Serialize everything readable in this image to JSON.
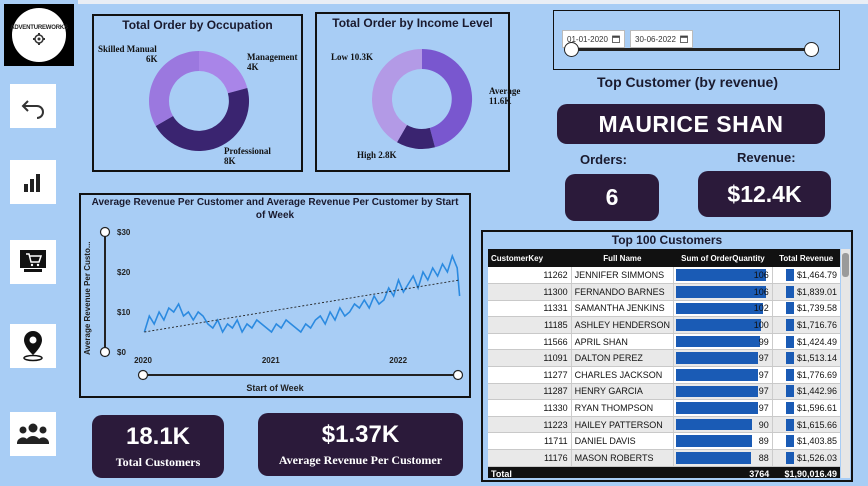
{
  "logo": {
    "text": "ADVENTUREWORKS"
  },
  "nav": [
    {
      "name": "back-icon"
    },
    {
      "name": "bar-chart-icon"
    },
    {
      "name": "shopping-cart-icon"
    },
    {
      "name": "map-pin-icon"
    },
    {
      "name": "people-icon"
    }
  ],
  "occupation": {
    "title": "Total Order by Occupation",
    "skilled_manual": "Skilled Manual",
    "skilled_manual_val": "6K",
    "management": "Management",
    "management_val": "4K",
    "professional": "Professional",
    "professional_val": "8K",
    "colors": [
      "#a985e8",
      "#7a57c9",
      "#3a2470"
    ]
  },
  "income": {
    "title": "Total Order by Income Level",
    "low": "Low 10.3K",
    "average": "Average",
    "average_val": "11.6K",
    "high": "High 2.8K",
    "colors": [
      "#b39ae6",
      "#7957cf",
      "#3a2470"
    ]
  },
  "date_slicer": {
    "start": "01-01-2020",
    "end": "30-06-2022"
  },
  "top_customer": {
    "label": "Top Customer (by revenue)",
    "name": "MAURICE SHAN",
    "orders_label": "Orders:",
    "orders_value": "6",
    "revenue_label": "Revenue:",
    "revenue_value": "$12.4K"
  },
  "line_chart": {
    "title": "Average Revenue Per Customer and Average Revenue Per Customer by Start of Week",
    "ylabel": "Average Revenue Per Custo...",
    "xlabel": "Start of Week",
    "yticks": [
      "$30",
      "$20",
      "$10",
      "$0"
    ],
    "xticks": [
      "2020",
      "2021",
      "2022"
    ]
  },
  "chart_data": {
    "type": "line",
    "title": "Average Revenue Per Customer and Average Revenue Per Customer by Start of Week",
    "xlabel": "Start of Week",
    "ylabel": "Average Revenue Per Custo...",
    "ylim": [
      0,
      30
    ],
    "x_range": [
      "2020-01-01",
      "2022-06-30"
    ],
    "series": [
      {
        "x": [
          "2020-01-05",
          "2020-01-19",
          "2020-02-02",
          "2020-02-16",
          "2020-03-01",
          "2020-03-15",
          "2020-03-29",
          "2020-04-12",
          "2020-04-26",
          "2020-05-10",
          "2020-05-24",
          "2020-06-07",
          "2020-06-21",
          "2020-07-05",
          "2020-07-19",
          "2020-08-02",
          "2020-08-16",
          "2020-08-30",
          "2020-09-13",
          "2020-09-27",
          "2020-10-11",
          "2020-10-25",
          "2020-11-08",
          "2020-11-22",
          "2020-12-06",
          "2020-12-20",
          "2021-01-03",
          "2021-01-17",
          "2021-01-31",
          "2021-02-14",
          "2021-02-28",
          "2021-03-14",
          "2021-03-28",
          "2021-04-11",
          "2021-04-25",
          "2021-05-09",
          "2021-05-23",
          "2021-06-06",
          "2021-06-20",
          "2021-07-04",
          "2021-07-18",
          "2021-08-01",
          "2021-08-15",
          "2021-08-29",
          "2021-09-12",
          "2021-09-26",
          "2021-10-10",
          "2021-10-24",
          "2021-11-07",
          "2021-11-21",
          "2021-12-05",
          "2021-12-19",
          "2022-01-02",
          "2022-01-16",
          "2022-01-30",
          "2022-02-13",
          "2022-02-27",
          "2022-03-13",
          "2022-03-27",
          "2022-04-10",
          "2022-04-24",
          "2022-05-08",
          "2022-05-22",
          "2022-06-05",
          "2022-06-19",
          "2022-06-26"
        ],
        "values": [
          5,
          9,
          7,
          10,
          8,
          11,
          10,
          12,
          9,
          10,
          8,
          10,
          9,
          7,
          6,
          8,
          5,
          7,
          6,
          8,
          5,
          7,
          6,
          8,
          7,
          6,
          5,
          7,
          6,
          8,
          7,
          6,
          5,
          7,
          6,
          8,
          9,
          7,
          10,
          8,
          11,
          9,
          10,
          12,
          11,
          13,
          11,
          14,
          12,
          13,
          16,
          14,
          18,
          15,
          17,
          19,
          16,
          20,
          18,
          21,
          19,
          22,
          20,
          24,
          21,
          14
        ]
      },
      {
        "x": [
          "2020-01-05",
          "2022-06-26"
        ],
        "values": [
          5,
          18
        ]
      }
    ]
  },
  "kpis": {
    "total_customers_value": "18.1K",
    "total_customers_label": "Total Customers",
    "avg_rev_value": "$1.37K",
    "avg_rev_label": "Average Revenue Per Customer"
  },
  "table": {
    "title": "Top 100 Customers",
    "headers": [
      "CustomerKey",
      "Full Name",
      "Sum of OrderQuantity",
      "Total Revenue"
    ],
    "qty_max": 106,
    "rows": [
      {
        "key": "11262",
        "name": "JENNIFER SIMMONS",
        "qty": "106",
        "qty_n": 106,
        "rev": "$1,464.79"
      },
      {
        "key": "11300",
        "name": "FERNANDO BARNES",
        "qty": "106",
        "qty_n": 106,
        "rev": "$1,839.01"
      },
      {
        "key": "11331",
        "name": "SAMANTHA JENKINS",
        "qty": "102",
        "qty_n": 102,
        "rev": "$1,739.58"
      },
      {
        "key": "11185",
        "name": "ASHLEY HENDERSON",
        "qty": "100",
        "qty_n": 100,
        "rev": "$1,716.76"
      },
      {
        "key": "11566",
        "name": "APRIL SHAN",
        "qty": "99",
        "qty_n": 99,
        "rev": "$1,424.49"
      },
      {
        "key": "11091",
        "name": "DALTON PEREZ",
        "qty": "97",
        "qty_n": 97,
        "rev": "$1,513.14"
      },
      {
        "key": "11277",
        "name": "CHARLES JACKSON",
        "qty": "97",
        "qty_n": 97,
        "rev": "$1,776.69"
      },
      {
        "key": "11287",
        "name": "HENRY GARCIA",
        "qty": "97",
        "qty_n": 97,
        "rev": "$1,442.96"
      },
      {
        "key": "11330",
        "name": "RYAN THOMPSON",
        "qty": "97",
        "qty_n": 97,
        "rev": "$1,596.61"
      },
      {
        "key": "11223",
        "name": "HAILEY PATTERSON",
        "qty": "90",
        "qty_n": 90,
        "rev": "$1,615.66"
      },
      {
        "key": "11711",
        "name": "DANIEL DAVIS",
        "qty": "89",
        "qty_n": 89,
        "rev": "$1,403.85"
      },
      {
        "key": "11176",
        "name": "MASON ROBERTS",
        "qty": "88",
        "qty_n": 88,
        "rev": "$1,526.03"
      }
    ],
    "total_label": "Total",
    "total_qty": "3764",
    "total_rev": "$1,90,016.49"
  }
}
